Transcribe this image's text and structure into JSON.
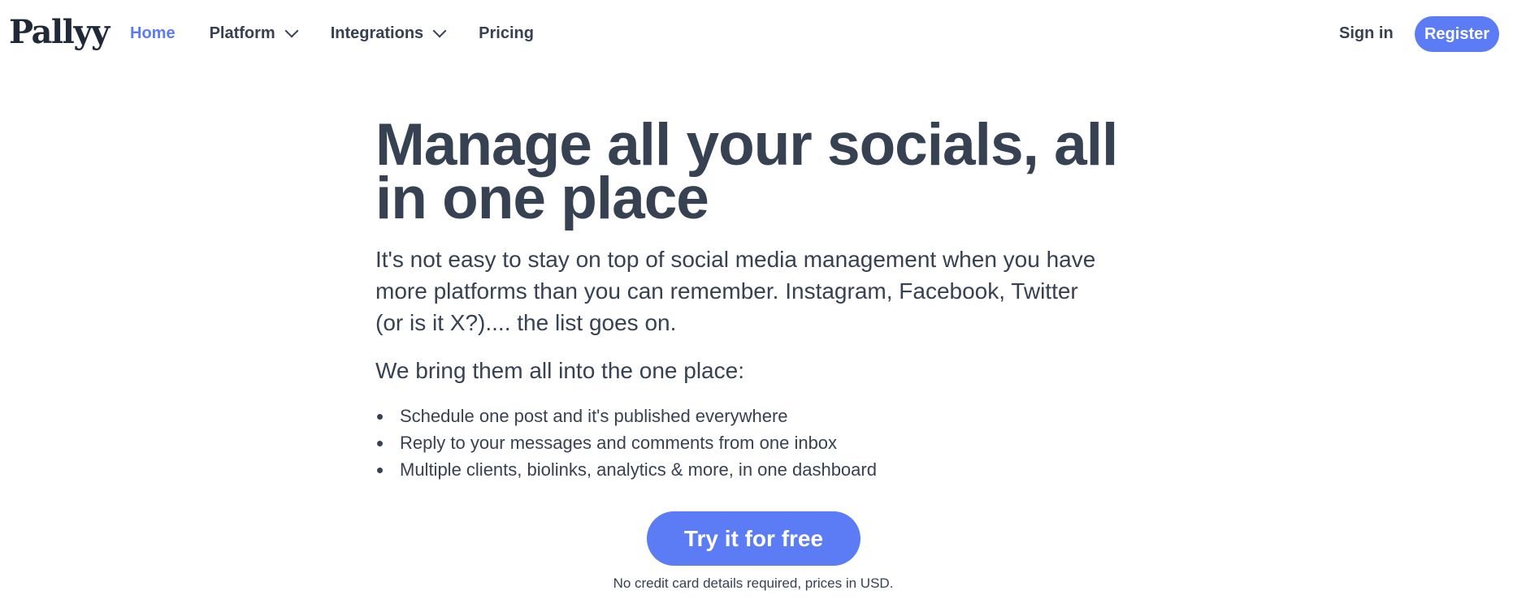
{
  "nav": {
    "logo": "Pallyy",
    "links": [
      {
        "label": "Home",
        "active": true,
        "has_dropdown": false
      },
      {
        "label": "Platform",
        "active": false,
        "has_dropdown": true
      },
      {
        "label": "Integrations",
        "active": false,
        "has_dropdown": true
      },
      {
        "label": "Pricing",
        "active": false,
        "has_dropdown": false
      }
    ],
    "sign_in": "Sign in",
    "register": "Register"
  },
  "hero": {
    "headline": "Manage all your socials, all in one place",
    "intro": "It's not easy to stay on top of social media management when you have more platforms than you can remember. Instagram, Facebook, Twitter (or is it X?).... the list goes on.",
    "subhead": "We bring them all into the one place:",
    "bullets": [
      "Schedule one post and it's published everywhere",
      "Reply to your messages and comments from one inbox",
      "Multiple clients, biolinks, analytics & more, in one dashboard"
    ],
    "cta": "Try it for free",
    "fineprint": "No credit card details required, prices in USD."
  },
  "colors": {
    "accent": "#5b7cf5",
    "text": "#364152",
    "background": "#ffffff"
  },
  "icons": {
    "dropdown": "chevron-down-icon",
    "bullet": "bullet-dot-icon"
  }
}
